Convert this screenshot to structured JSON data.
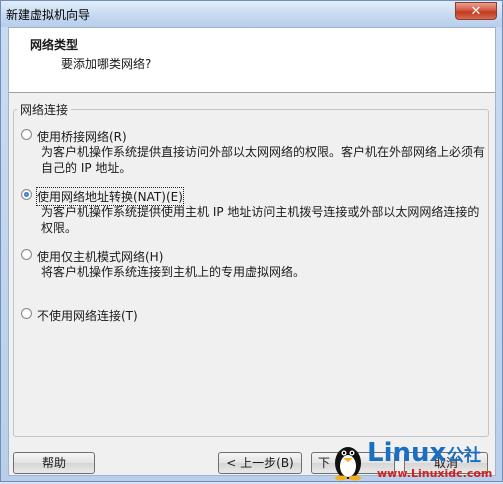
{
  "window": {
    "title": "新建虚拟机向导",
    "close_glyph": "✕"
  },
  "header": {
    "title": "网络类型",
    "subtitle": "要添加哪类网络?"
  },
  "group": {
    "legend": "网络连接"
  },
  "options": [
    {
      "label": "使用桥接网络(R)",
      "description": "为客户机操作系统提供直接访问外部以太网网络的权限。客户机在外部网络上必须有自己的 IP 地址。",
      "selected": false
    },
    {
      "label": "使用网络地址转换(NAT)(E)",
      "description": "为客户机操作系统提供使用主机 IP 地址访问主机拨号连接或外部以太网网络连接的权限。",
      "selected": true
    },
    {
      "label": "使用仅主机模式网络(H)",
      "description": "将客户机操作系统连接到主机上的专用虚拟网络。",
      "selected": false
    },
    {
      "label": "不使用网络连接(T)",
      "description": "",
      "selected": false
    }
  ],
  "buttons": {
    "help": "帮助",
    "back": "< 上一步(B)",
    "next": "下",
    "cancel": "取消"
  },
  "watermark": {
    "brand": "Linux",
    "suffix": "公社",
    "url": "www.Linuxidc.com"
  }
}
